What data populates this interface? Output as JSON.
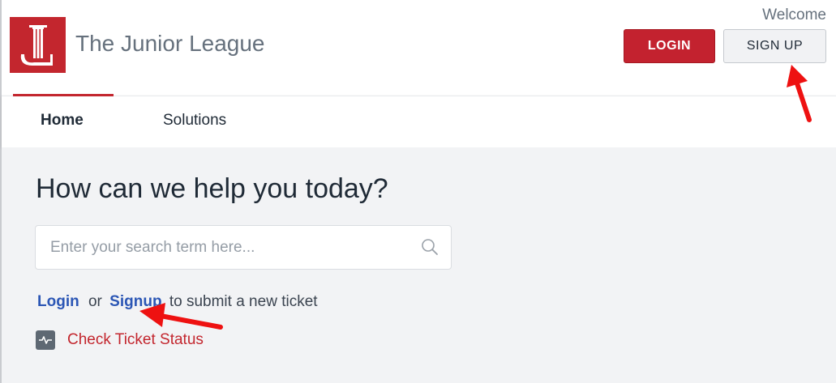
{
  "header": {
    "brand_name": "The Junior League",
    "welcome_text": "Welcome",
    "login_label": "LOGIN",
    "signup_label": "SIGN UP"
  },
  "nav": {
    "tabs": [
      {
        "label": "Home",
        "active": true
      },
      {
        "label": "Solutions",
        "active": false
      }
    ]
  },
  "main": {
    "title": "How can we help you today?",
    "search": {
      "placeholder": "Enter your search term here...",
      "value": ""
    },
    "ticket": {
      "login_link": "Login",
      "or_text": "or",
      "signup_link": "Signup",
      "suffix_text": "to submit a new ticket"
    },
    "status_link": "Check Ticket Status"
  },
  "colors": {
    "brand_red": "#c3262e",
    "link_blue": "#2b56b5",
    "annotation_arrow": "#ee1111",
    "page_background": "#f2f3f5"
  },
  "icons": {
    "logo": "junior-league-column-logo",
    "search": "search-icon",
    "status": "pulse-icon"
  }
}
